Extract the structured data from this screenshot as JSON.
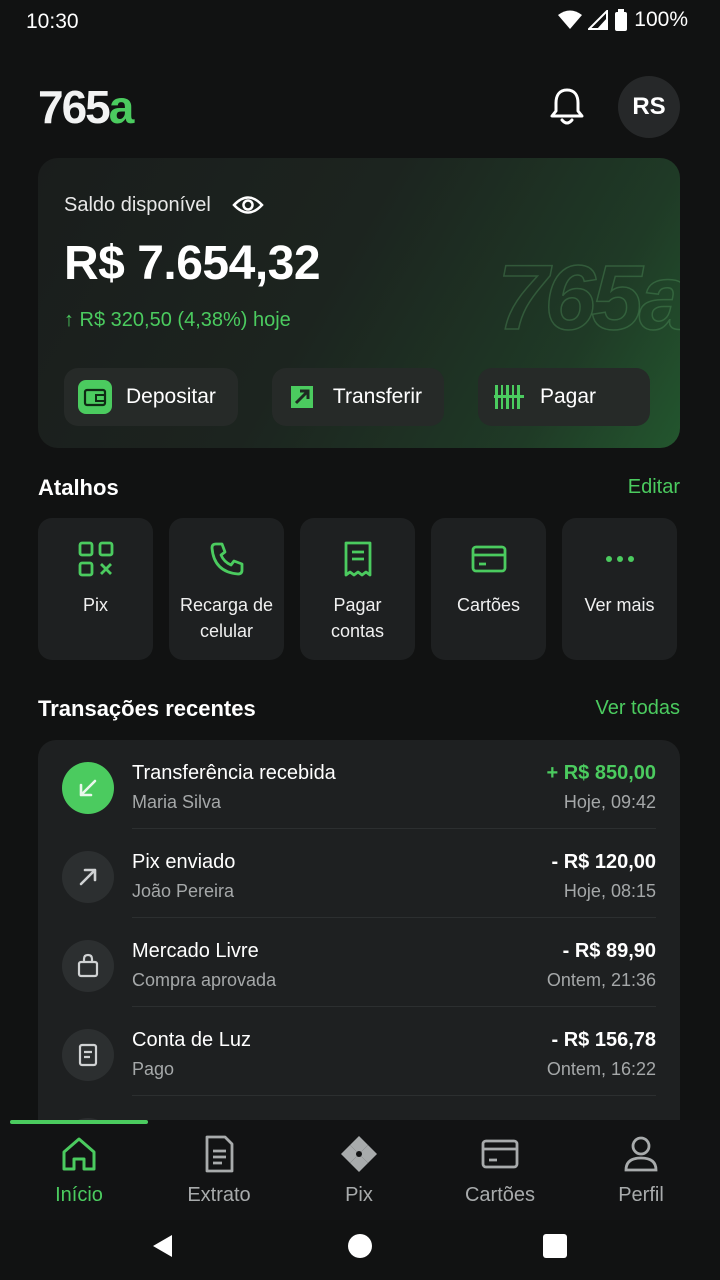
{
  "status_bar": {
    "time": "10:30",
    "battery": "100%"
  },
  "header": {
    "logo_main": "765",
    "logo_accent": "a",
    "avatar_initials": "RS"
  },
  "balance": {
    "label": "Saldo disponível",
    "amount": "R$ 7.654,32",
    "change": "↑ R$ 320,50 (4,38%) hoje",
    "watermark": "765a",
    "actions": [
      {
        "label": "Depositar",
        "icon": "wallet-icon"
      },
      {
        "label": "Transferir",
        "icon": "transfer-icon"
      },
      {
        "label": "Pagar",
        "icon": "barcode-icon"
      }
    ]
  },
  "shortcuts": {
    "title": "Atalhos",
    "edit_label": "Editar",
    "items": [
      {
        "label": "Pix",
        "icon": "pix-qr-icon"
      },
      {
        "label": "Recarga de\ncelular",
        "icon": "phone-icon"
      },
      {
        "label": "Pagar\ncontas",
        "icon": "receipt-icon"
      },
      {
        "label": "Cartões",
        "icon": "card-icon"
      },
      {
        "label": "Ver mais",
        "icon": "more-icon"
      }
    ]
  },
  "transactions": {
    "title": "Transações recentes",
    "see_all_label": "Ver todas",
    "items": [
      {
        "title": "Transferência recebida",
        "subtitle": "Maria Silva",
        "amount": "+ R$ 850,00",
        "date": "Hoje, 09:42",
        "icon": "arrow-down-left-icon"
      },
      {
        "title": "Pix enviado",
        "subtitle": "João Pereira",
        "amount": "- R$ 120,00",
        "date": "Hoje, 08:15",
        "icon": "arrow-up-right-icon"
      },
      {
        "title": "Mercado Livre",
        "subtitle": "Compra aprovada",
        "amount": "- R$ 89,90",
        "date": "Ontem, 21:36",
        "icon": "shopping-bag-icon"
      },
      {
        "title": "Conta de Luz",
        "subtitle": "Pago",
        "amount": "- R$ 156,78",
        "date": "Ontem, 16:22",
        "icon": "bill-icon"
      }
    ]
  },
  "bottom_nav": [
    {
      "label": "Início",
      "icon": "home-icon",
      "active": true
    },
    {
      "label": "Extrato",
      "icon": "statement-icon",
      "active": false
    },
    {
      "label": "Pix",
      "icon": "pix-icon",
      "active": false
    },
    {
      "label": "Cartões",
      "icon": "card-icon",
      "active": false
    },
    {
      "label": "Perfil",
      "icon": "person-icon",
      "active": false
    }
  ],
  "colors": {
    "accent": "#4bcb5f",
    "background": "#111212",
    "card": "#1e2021"
  }
}
